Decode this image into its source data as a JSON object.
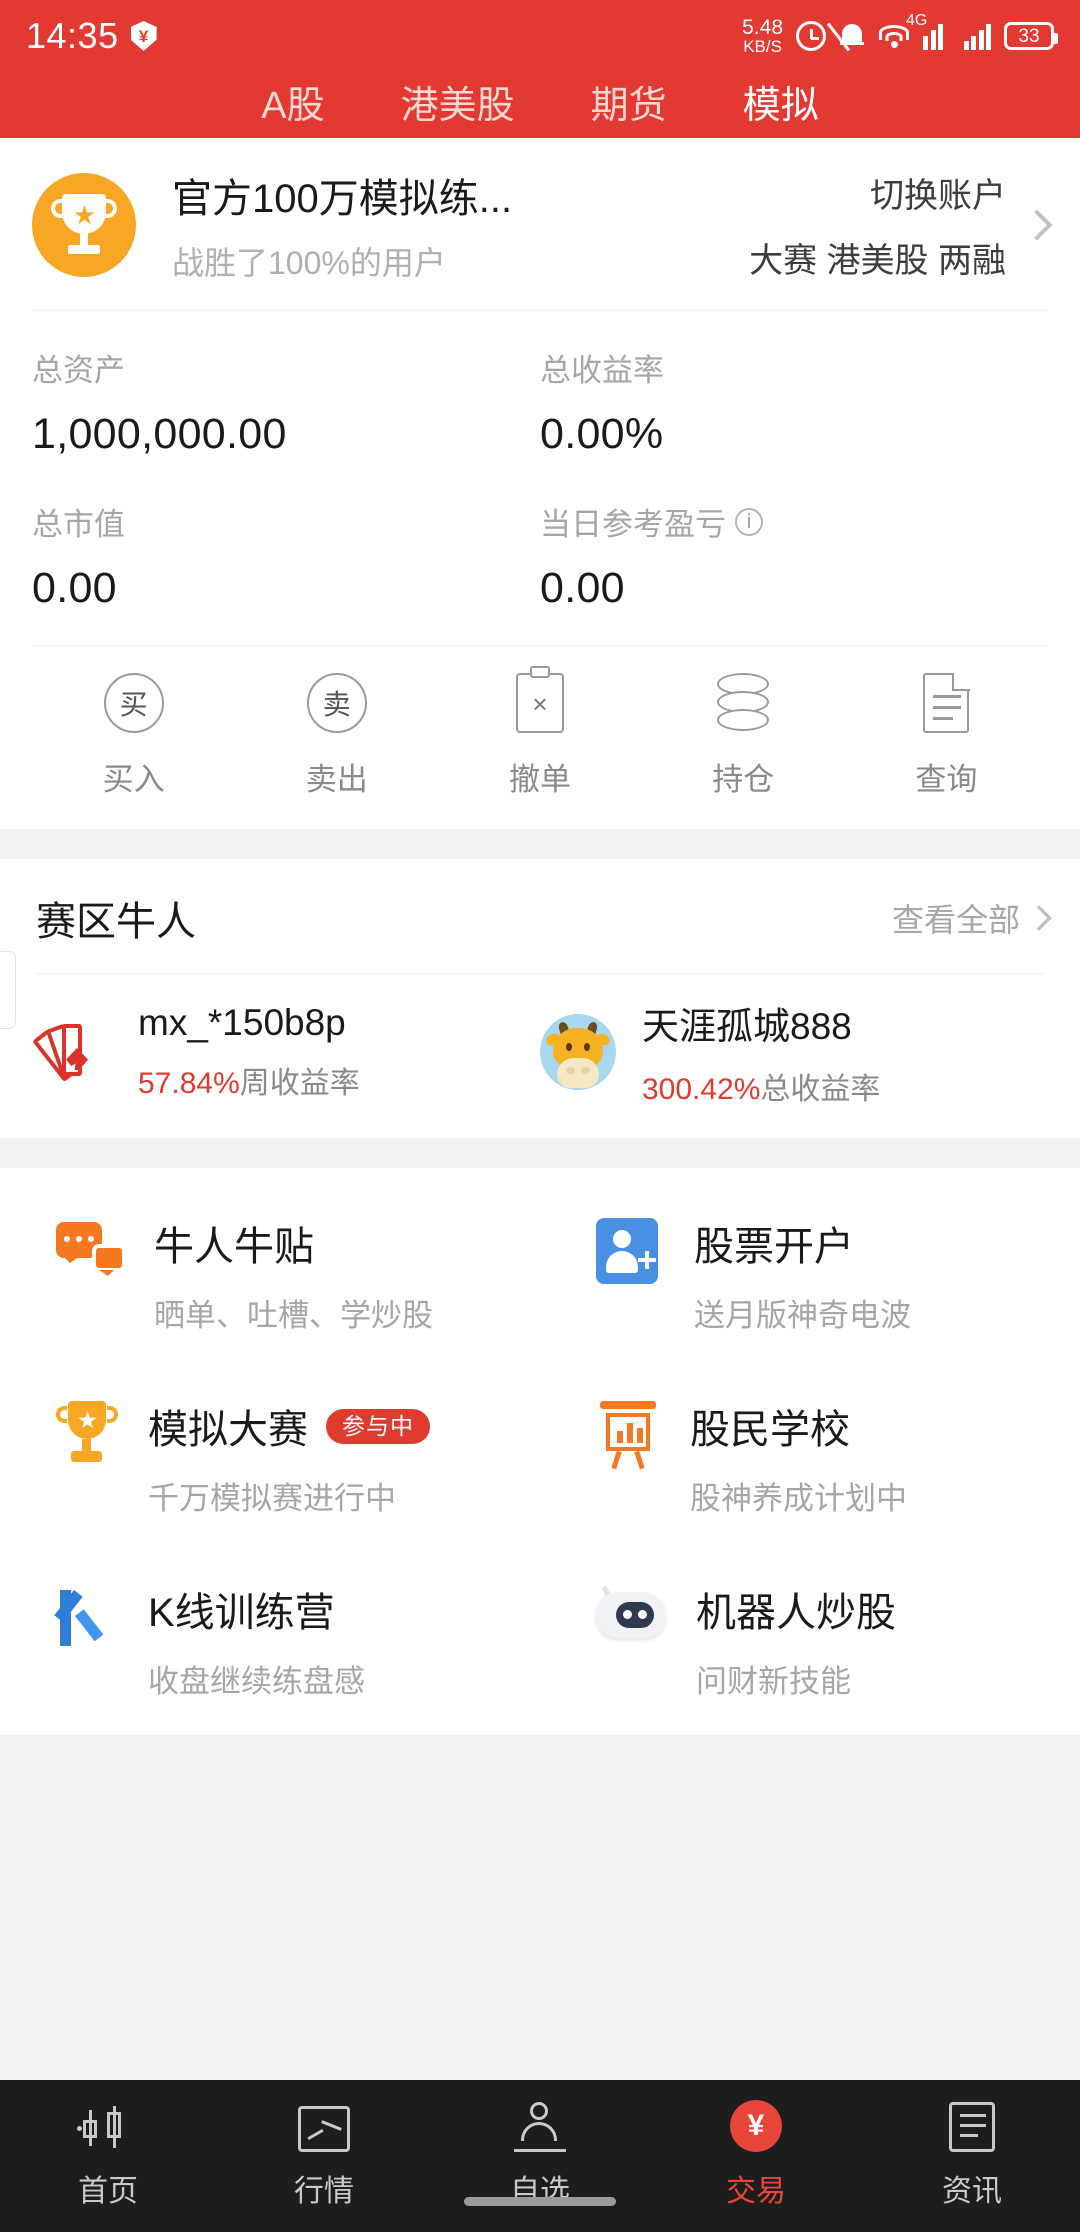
{
  "statusbar": {
    "time": "14:35",
    "shield_symbol": "¥",
    "net_speed_value": "5.48",
    "net_speed_unit": "KB/S",
    "network_type": "4G",
    "battery": "33"
  },
  "top_tabs": [
    {
      "label": "A股",
      "active": false
    },
    {
      "label": "港美股",
      "active": false
    },
    {
      "label": "期货",
      "active": false
    },
    {
      "label": "模拟",
      "active": true
    }
  ],
  "account": {
    "name": "官方100万模拟练...",
    "subtitle": "战胜了100%的用户",
    "switch_label": "切换账户",
    "tags": "大赛 港美股 两融"
  },
  "stats": [
    {
      "label": "总资产",
      "value": "1,000,000.00",
      "info": false
    },
    {
      "label": "总收益率",
      "value": "0.00%",
      "info": false
    },
    {
      "label": "总市值",
      "value": "0.00",
      "info": false
    },
    {
      "label": "当日参考盈亏",
      "value": "0.00",
      "info": true
    }
  ],
  "actions": [
    {
      "label": "买入",
      "glyph": "买"
    },
    {
      "label": "卖出",
      "glyph": "卖"
    },
    {
      "label": "撤单",
      "glyph": "×"
    },
    {
      "label": "持仓",
      "glyph": ""
    },
    {
      "label": "查询",
      "glyph": ""
    }
  ],
  "niuren": {
    "title": "赛区牛人",
    "more": "查看全部",
    "items": [
      {
        "name": "mx_*150b8p",
        "rate": "57.84%",
        "rate_label": "周收益率"
      },
      {
        "name": "天涯孤城888",
        "rate": "300.42%",
        "rate_label": "总收益率"
      }
    ]
  },
  "features": [
    {
      "title": "牛人牛贴",
      "desc": "晒单、吐槽、学炒股",
      "badge": ""
    },
    {
      "title": "股票开户",
      "desc": "送月版神奇电波",
      "badge": ""
    },
    {
      "title": "模拟大赛",
      "desc": "千万模拟赛进行中",
      "badge": "参与中"
    },
    {
      "title": "股民学校",
      "desc": "股神养成计划中",
      "badge": ""
    },
    {
      "title": "K线训练营",
      "desc": "收盘继续练盘感",
      "badge": ""
    },
    {
      "title": "机器人炒股",
      "desc": "问财新技能",
      "badge": ""
    }
  ],
  "bottom_nav": [
    {
      "label": "首页",
      "active": false
    },
    {
      "label": "行情",
      "active": false
    },
    {
      "label": "自选",
      "active": false
    },
    {
      "label": "交易",
      "active": true,
      "glyph": "¥"
    },
    {
      "label": "资讯",
      "active": false
    }
  ],
  "colors": {
    "brand_red": "#e23a32",
    "accent_orange": "#f7a723",
    "gain_red": "#e03b2f",
    "nav_bg": "#1d1d1d"
  }
}
